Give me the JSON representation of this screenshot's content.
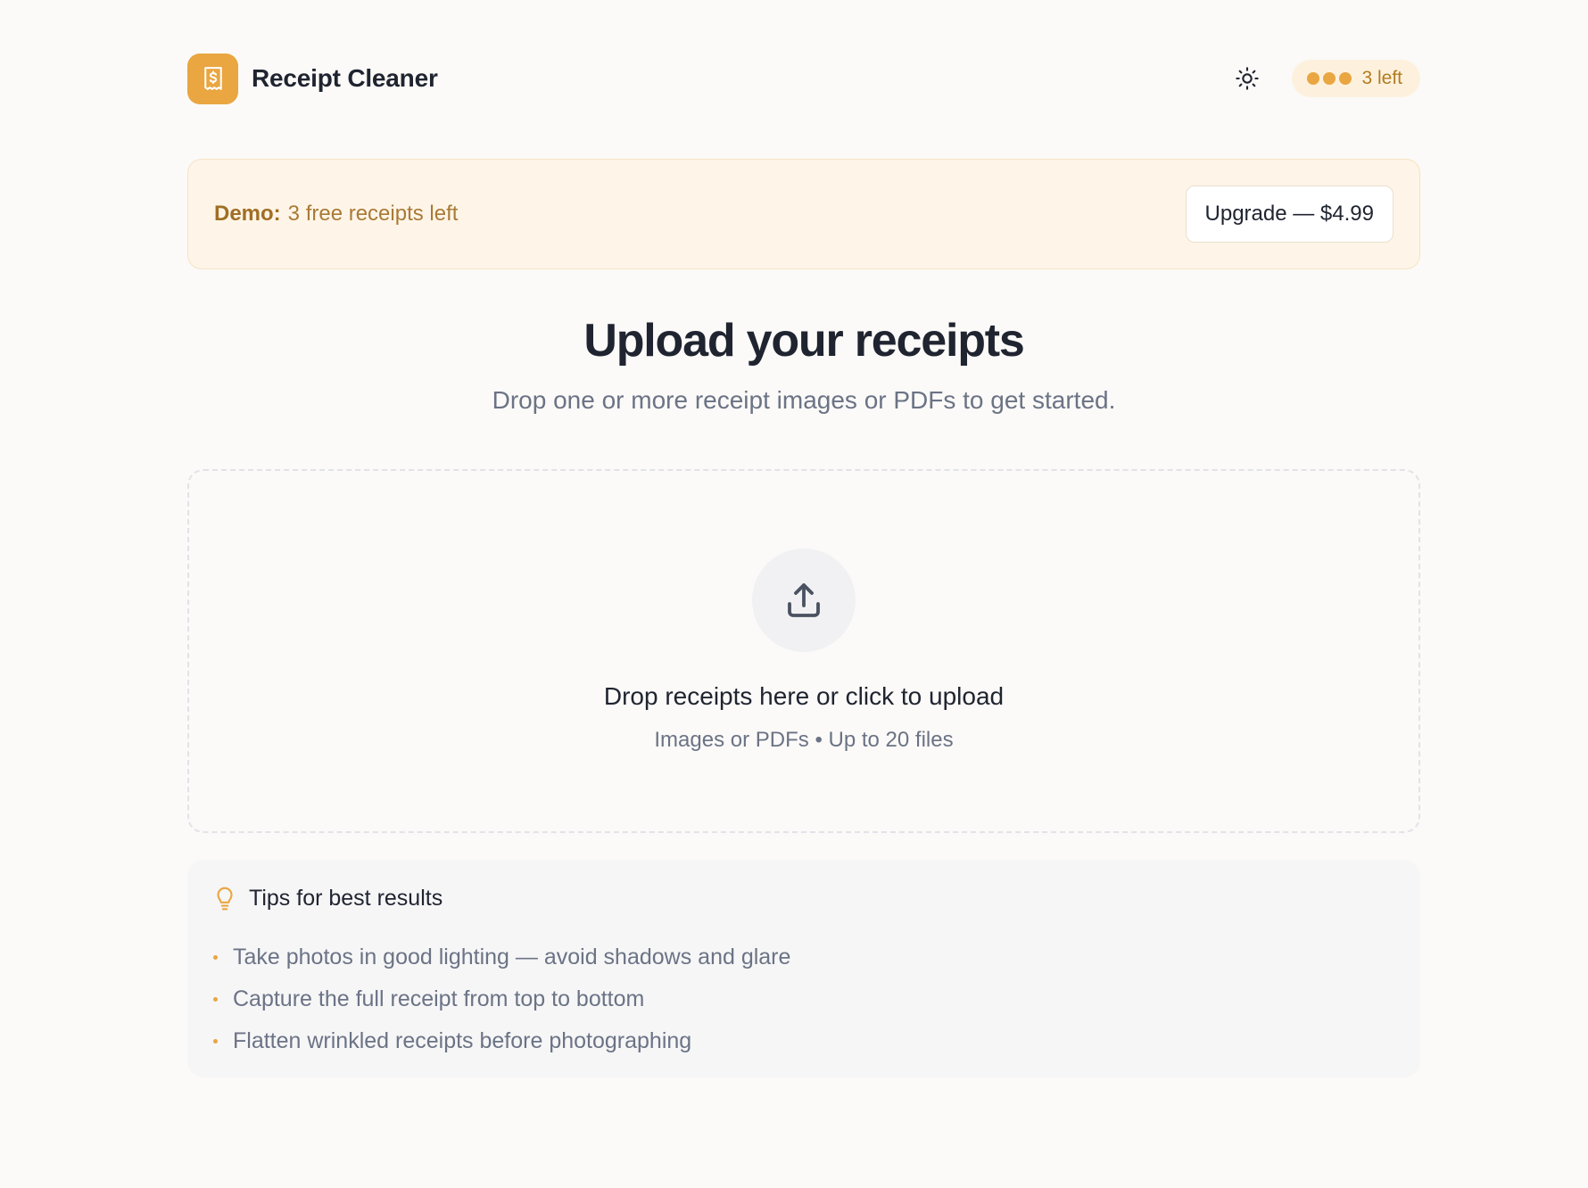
{
  "app": {
    "name": "Receipt Cleaner"
  },
  "header": {
    "theme_icon": "sun-icon",
    "credits": {
      "dots_filled": 3,
      "label": "3 left"
    }
  },
  "banner": {
    "label": "Demo:",
    "text": "3 free receipts left",
    "button": "Upgrade — $4.99"
  },
  "hero": {
    "title": "Upload your receipts",
    "subtitle": "Drop one or more receipt images or PDFs to get started."
  },
  "dropzone": {
    "icon": "upload-icon",
    "title": "Drop receipts here or click to upload",
    "subtitle": "Images or PDFs • Up to 20 files"
  },
  "tips": {
    "icon": "lightbulb-icon",
    "title": "Tips for best results",
    "items": [
      "Take photos in good lighting — avoid shadows and glare",
      "Capture the full receipt from top to bottom",
      "Flatten wrinkled receipts before photographing"
    ]
  },
  "colors": {
    "accent": "#e9a641",
    "banner_bg": "#fef5e8",
    "page_bg": "#fbfaf8",
    "text_muted": "#6b7385"
  }
}
